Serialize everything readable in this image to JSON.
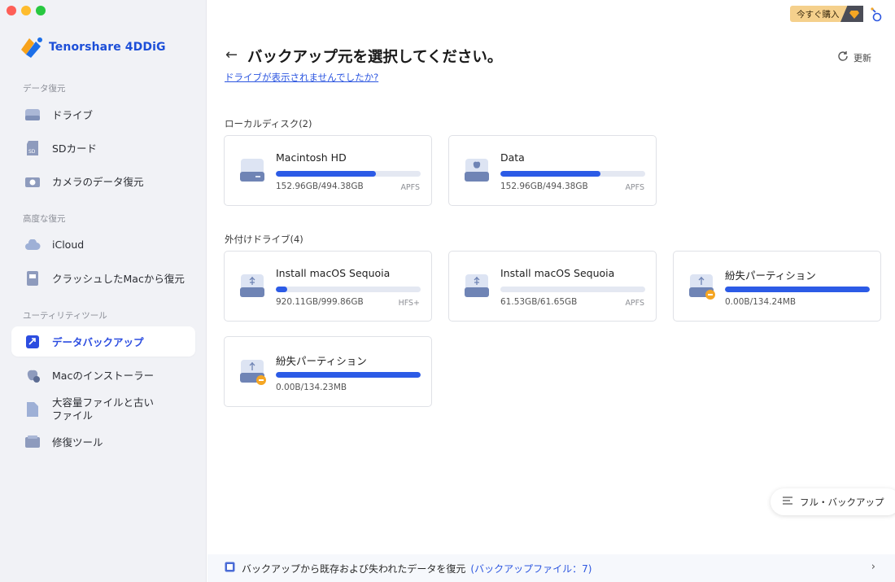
{
  "app": {
    "name": "Tenorshare 4DDiG"
  },
  "sidebar": {
    "sections": [
      {
        "label": "データ復元"
      },
      {
        "label": "高度な復元"
      },
      {
        "label": "ユーティリティツール"
      }
    ],
    "items": [
      {
        "label": "ドライブ",
        "icon": "drive-icon"
      },
      {
        "label": "SDカード",
        "icon": "sd-card-icon"
      },
      {
        "label": "カメラのデータ復元",
        "icon": "camera-icon"
      },
      {
        "label": "iCloud",
        "icon": "cloud-icon"
      },
      {
        "label": "クラッシュしたMacから復元",
        "icon": "crashed-mac-icon"
      },
      {
        "label": "データバックアップ",
        "icon": "backup-icon",
        "active": true
      },
      {
        "label": "Macのインストーラー",
        "icon": "apple-installer-icon"
      },
      {
        "label_line1": "大容量ファイルと古い",
        "label_line2": "ファイル",
        "icon": "file-icon"
      },
      {
        "label": "修復ツール",
        "icon": "repair-tool-icon"
      }
    ]
  },
  "header": {
    "buy_label": "今すぐ購入",
    "title": "バックアップ元を選択してください。",
    "help_link": "ドライブが表示されませんでしたか?",
    "refresh_label": "更新"
  },
  "local_disks": {
    "label": "ローカルディスク(2)",
    "items": [
      {
        "name": "Macintosh HD",
        "size": "152.96GB/494.38GB",
        "fs": "APFS",
        "fill": 0.69
      },
      {
        "name": "Data",
        "size": "152.96GB/494.38GB",
        "fs": "APFS",
        "fill": 0.69
      }
    ]
  },
  "external_drives": {
    "label": "外付けドライブ(4)",
    "items": [
      {
        "name": "Install macOS Sequoia",
        "size": "920.11GB/999.86GB",
        "fs": "HFS+",
        "fill": 0.08
      },
      {
        "name": "Install macOS Sequoia",
        "size": "61.53GB/61.65GB",
        "fs": "APFS",
        "fill": 0.0
      },
      {
        "name": "紛失パーティション",
        "size": "0.00B/134.24MB",
        "fs": "",
        "fill": 1.0
      },
      {
        "name": "紛失パーティション",
        "size": "0.00B/134.23MB",
        "fs": "",
        "fill": 1.0
      }
    ]
  },
  "full_backup_label": "フル・バックアップ",
  "bottom_bar": {
    "text": "バックアップから既存および失われたデータを復元",
    "count": "(バックアップファイル：7)"
  },
  "colors": {
    "accent": "#2c5be6",
    "buy": "#f5d08c"
  }
}
